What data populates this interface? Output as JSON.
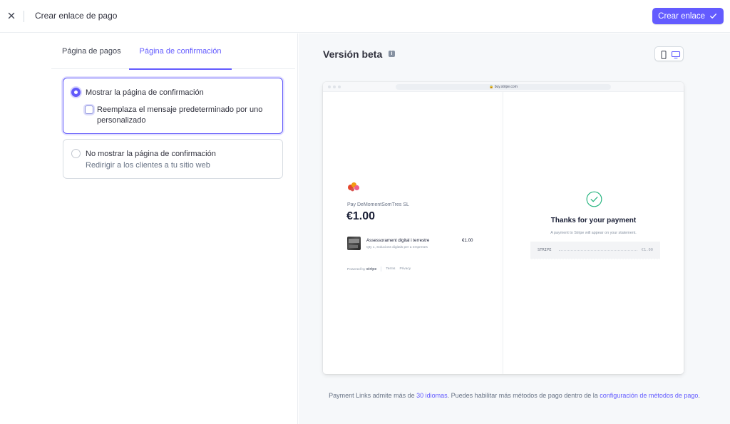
{
  "header": {
    "title": "Crear enlace de pago",
    "create_button_label": "Crear enlace",
    "accent_color": "#635bff"
  },
  "tabs": [
    {
      "label": "Página de pagos",
      "active": false
    },
    {
      "label": "Página de confirmación",
      "active": true
    }
  ],
  "options": {
    "show": {
      "label": "Mostrar la página de confirmación",
      "selected": true,
      "checkbox_label": "Reemplaza el mensaje predeterminado por uno personalizado",
      "checkbox_checked": false
    },
    "hide": {
      "label": "No mostrar la página de confirmación",
      "description": "Redirigir a los clientes a tu sitio web",
      "selected": false
    }
  },
  "preview": {
    "title": "Versión beta",
    "info_icon": "i",
    "url": "buy.stripe.com",
    "merchant": {
      "name": "Pay DeMomentSomTres SL",
      "price": "€1.00"
    },
    "item": {
      "name": "Assessorament digital i terrestre",
      "subtitle": "Qty 1, Solucions digitals per a empreses",
      "price": "€1.00"
    },
    "footer": {
      "powered_by": "Powered by",
      "brand": "stripe",
      "terms": "Terms",
      "privacy": "Privacy"
    },
    "confirmation": {
      "heading": "Thanks for your payment",
      "statement_note": "A payment to Stripe will appear on your statement.",
      "receipt_label": "STRIPE",
      "receipt_amount": "€1.00"
    }
  },
  "bottom_note": {
    "part1": "Payment Links admite más de ",
    "link1": "30 idiomas",
    "part2": ". Puedes habilitar más métodos de pago dentro de la ",
    "link2": "configuración de métodos de pago",
    "part3": "."
  }
}
